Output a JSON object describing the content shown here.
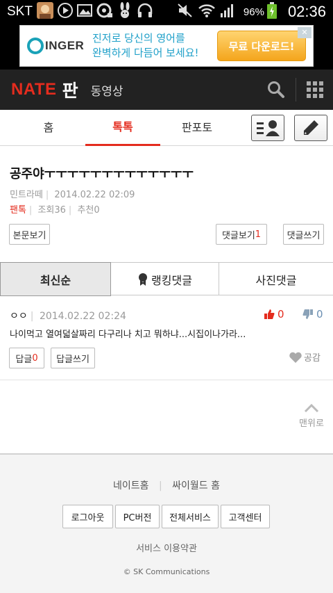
{
  "status_bar": {
    "carrier": "SKT",
    "battery": "96%",
    "time": "02:36",
    "icons": [
      "avatar-icon",
      "play-icon",
      "gallery-icon",
      "sync-icon",
      "bunny-icon",
      "headphones-icon",
      "mute-icon",
      "wifi-icon",
      "signal-icon",
      "battery-charging-icon"
    ]
  },
  "ad": {
    "brand": "INGER",
    "line1": "진저로 당신의 영어를",
    "line2": "완벽하게 다듬어 보세요!",
    "cta": "무료 다운로드!"
  },
  "header": {
    "brand": "NATE",
    "service": "판",
    "video_link": "동영상"
  },
  "tabs": [
    {
      "label": "홈",
      "active": false
    },
    {
      "label": "톡톡",
      "active": true
    },
    {
      "label": "판포토",
      "active": false
    }
  ],
  "post": {
    "title": "공주야ㅜㅜㅜㅜㅜㅜㅜㅜㅜㅜㅜㅜㅜ",
    "author": "민트라떼",
    "date": "2014.02.22 02:09",
    "category": "팬톡",
    "views": "조회36",
    "recommend": "추천0",
    "view_original": "본문보기",
    "view_comments_label": "댓글보기",
    "comment_count": "1",
    "write_comment": "댓글쓰기"
  },
  "comment_tabs": [
    {
      "label": "최신순",
      "active": true
    },
    {
      "label": "랭킹댓글",
      "active": false
    },
    {
      "label": "사진댓글",
      "active": false
    }
  ],
  "comments": [
    {
      "author": "ㅇㅇ",
      "date": "2014.02.22 02:24",
      "text": "나이먹고 열여덟살짜리 다구리나 치고 뭐하냐...시집이나가라...",
      "up": "0",
      "down": "0",
      "reply_label": "답글",
      "reply_count": "0",
      "write_reply": "답글쓰기",
      "like_label": "공감"
    }
  ],
  "to_top": "맨위로",
  "footer": {
    "links": [
      "네이트홈",
      "싸이월드 홈"
    ],
    "buttons": [
      "로그아웃",
      "PC버전",
      "전체서비스",
      "고객센터"
    ],
    "terms": "서비스 이용약관",
    "copyright": "© SK Communications"
  },
  "colors": {
    "accent": "#e42c1e",
    "header_bg": "#222222",
    "ad_blue": "#1fa0c9",
    "ad_orange": "#f4a51c"
  }
}
